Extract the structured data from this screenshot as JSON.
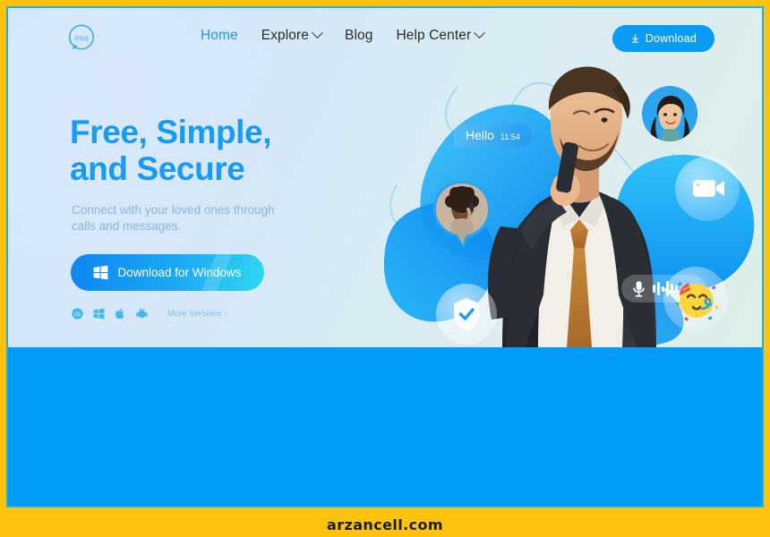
{
  "site": {
    "brand": "imo",
    "watermark": "arzancell.com"
  },
  "nav": {
    "logo_label": "imo",
    "items": [
      {
        "label": "Home",
        "active": true,
        "has_dropdown": false
      },
      {
        "label": "Explore",
        "active": false,
        "has_dropdown": true
      },
      {
        "label": "Blog",
        "active": false,
        "has_dropdown": false
      },
      {
        "label": "Help Center",
        "active": false,
        "has_dropdown": true
      }
    ],
    "download_button": "Download"
  },
  "hero": {
    "headline": "Free, Simple,\nand Secure",
    "subhead": "Connect with your loved ones through\ncalls and messages.",
    "cta_label": "Download for Windows",
    "more_versions": "More Versions ›",
    "platforms": [
      "macos-icon",
      "windows-icon",
      "apple-icon",
      "android-icon"
    ],
    "chat_bubble": {
      "text": "Hello",
      "time": "11:54"
    },
    "feature_icons": [
      "video-camera-icon",
      "microphone-icon",
      "shield-check-icon",
      "party-face-emoji"
    ],
    "avatars": [
      "avatar-woman-smiling",
      "avatar-woman-on-call"
    ]
  },
  "colors": {
    "brand_blue": "#179bf5",
    "nav_download_blue": "#0a9cf5",
    "band_blue": "#019bf8",
    "watermark_gold": "#ffc20e",
    "frame_cyan": "#17b4e9",
    "subhead_blue": "#88b7dd"
  }
}
